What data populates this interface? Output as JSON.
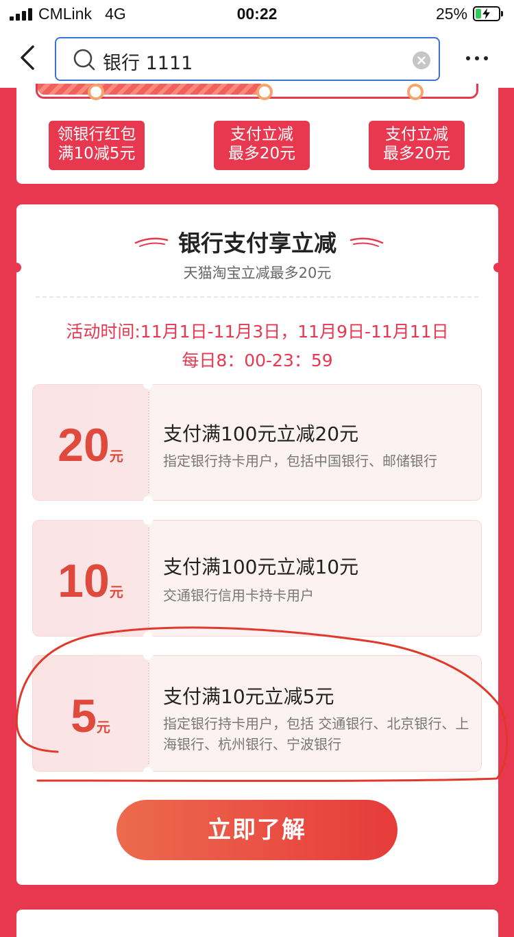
{
  "status_bar": {
    "carrier": "CMLink",
    "network": "4G",
    "time": "00:22",
    "battery_percent": "25%",
    "battery_level": 0.25
  },
  "nav": {
    "search_query": "银行 1111",
    "back_icon": "chevron-left-icon",
    "search_icon": "search-icon",
    "clear_icon": "clear-icon",
    "more_icon": "more-dots-icon"
  },
  "progress": {
    "steps": [
      {
        "line1": "领银行红包",
        "line2": "满10减5元"
      },
      {
        "line1": "支付立减",
        "line2": "最多20元"
      },
      {
        "line1": "支付立减",
        "line2": "最多20元"
      }
    ]
  },
  "main": {
    "title": "银行支付享立减",
    "subtitle": "天猫淘宝立减最多20元",
    "time_line1": "活动时间:11月1日-11月3日，11月9日-11月11日",
    "time_line2": "每日8：00-23：59",
    "coupons": [
      {
        "amount": "20",
        "unit": "元",
        "title": "支付满100元立减20元",
        "desc": "指定银行持卡用户，包括中国银行、邮储银行"
      },
      {
        "amount": "10",
        "unit": "元",
        "title": "支付满100元立减10元",
        "desc": "交通银行信用卡持卡用户"
      },
      {
        "amount": "5",
        "unit": "元",
        "title": "支付满10元立减5元",
        "desc": "指定银行持卡用户，包括 交通银行、北京银行、上海银行、杭州银行、宁波银行"
      }
    ],
    "cta_label": "立即了解"
  },
  "colors": {
    "page_background": "#e8384f",
    "accent_red": "#e8384f",
    "amount_red": "#e04a3c",
    "search_border": "#3a73d8",
    "annotation_stroke": "#e0392b"
  }
}
